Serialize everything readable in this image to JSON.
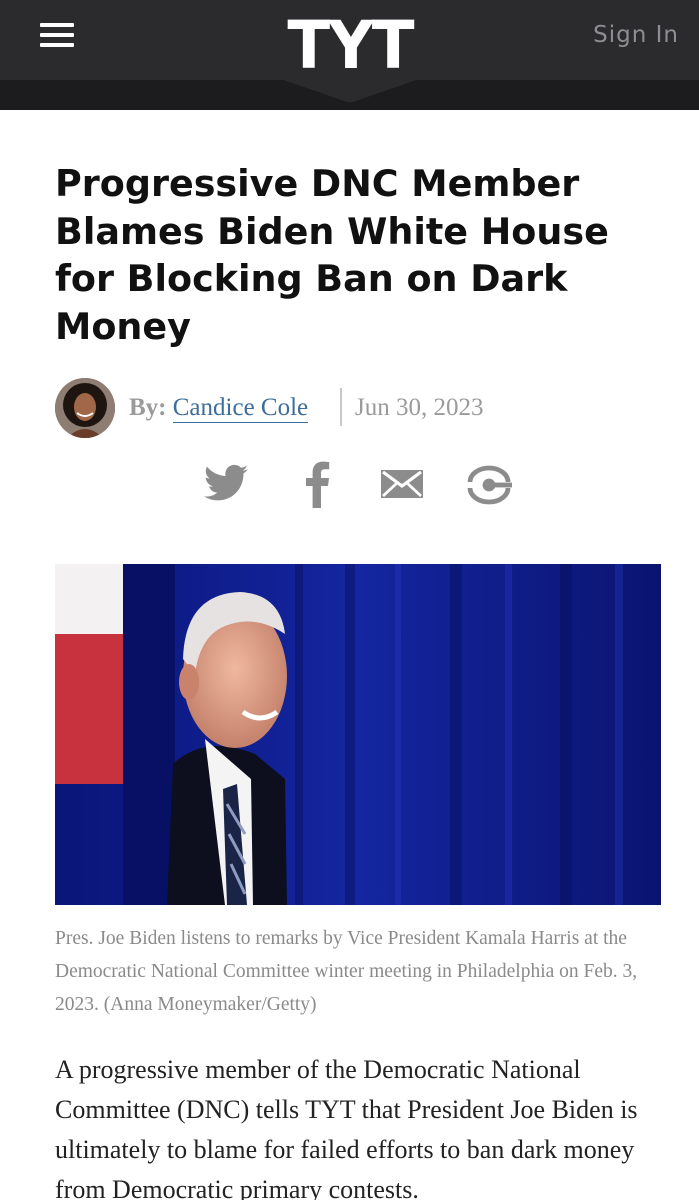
{
  "header": {
    "logo": "TYT",
    "signin_label": "Sign In"
  },
  "article": {
    "headline": "Progressive DNC Member Blames Biden White House for Blocking Ban on Dark Money",
    "byline_prefix": "By:",
    "author": "Candice Cole",
    "date": "Jun 30, 2023",
    "caption": "Pres. Joe Biden listens to remarks by Vice President Kamala Harris at the Democratic National Committee winter meeting in Philadelphia on Feb. 3, 2023.   (Anna Moneymaker/Getty)",
    "body": "A progressive member of the Democratic National Committee (DNC) tells TYT that President Joe Biden is ultimately to blame for failed efforts to ban dark money from Democratic primary contests."
  },
  "share": {
    "icons": [
      "twitter-icon",
      "facebook-icon",
      "email-icon",
      "more-share-icon"
    ]
  },
  "colors": {
    "header_bg": "#2b2b2d",
    "link": "#3d6d9a",
    "muted": "#9a9a9a"
  }
}
